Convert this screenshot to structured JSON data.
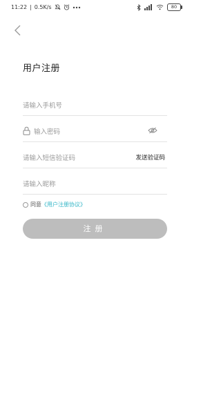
{
  "status_bar": {
    "time": "11:22",
    "separator": "|",
    "network_speed": "0.5K/s",
    "battery": "80",
    "icons": [
      "mute-icon",
      "alarm-icon",
      "more-icon",
      "bluetooth-icon",
      "signal-icon",
      "wifi-icon",
      "battery-icon"
    ]
  },
  "header": {
    "back_icon": "chevron-left-icon"
  },
  "title": "用户注册",
  "form": {
    "phone_placeholder": "请输入手机号",
    "password_placeholder": "输入密码",
    "sms_placeholder": "请输入短信验证码",
    "send_code_label": "发送验证码",
    "nickname_placeholder": "请输入昵称"
  },
  "agreement": {
    "prefix": "同意",
    "link_text": "《用户注册协议》"
  },
  "register_button": "注册",
  "colors": {
    "link": "#35b6c7",
    "button_bg": "#bdbdbd",
    "divider": "#e3e3e3"
  }
}
